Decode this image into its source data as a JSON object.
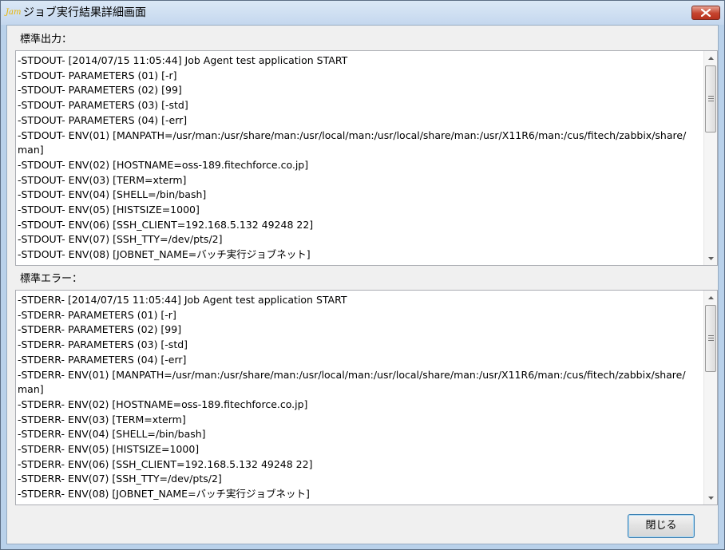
{
  "window": {
    "icon_text": "Jam",
    "title": "ジョブ実行結果詳細画面"
  },
  "stdout": {
    "label": "標準出力：",
    "lines": [
      "-STDOUT- [2014/07/15 11:05:44] Job Agent test application START",
      "-STDOUT- PARAMETERS (01) [-r]",
      "-STDOUT- PARAMETERS (02) [99]",
      "-STDOUT- PARAMETERS (03) [-std]",
      "-STDOUT- PARAMETERS (04) [-err]",
      "-STDOUT- ENV(01) [MANPATH=/usr/man:/usr/share/man:/usr/local/man:/usr/local/share/man:/usr/X11R6/man:/cus/fitech/zabbix/share/man]",
      "-STDOUT- ENV(02) [HOSTNAME=oss-189.fitechforce.co.jp]",
      "-STDOUT- ENV(03) [TERM=xterm]",
      "-STDOUT- ENV(04) [SHELL=/bin/bash]",
      "-STDOUT- ENV(05) [HISTSIZE=1000]",
      "-STDOUT- ENV(06) [SSH_CLIENT=192.168.5.132 49248 22]",
      "-STDOUT- ENV(07) [SSH_TTY=/dev/pts/2]",
      "-STDOUT- ENV(08) [JOBNET_NAME=バッチ実行ジョブネット]"
    ]
  },
  "stderr": {
    "label": "標準エラー：",
    "lines": [
      "-STDERR- [2014/07/15 11:05:44] Job Agent test application START",
      "-STDERR- PARAMETERS (01) [-r]",
      "-STDERR- PARAMETERS (02) [99]",
      "-STDERR- PARAMETERS (03) [-std]",
      "-STDERR- PARAMETERS (04) [-err]",
      "-STDERR- ENV(01) [MANPATH=/usr/man:/usr/share/man:/usr/local/man:/usr/local/share/man:/usr/X11R6/man:/cus/fitech/zabbix/share/man]",
      "-STDERR- ENV(02) [HOSTNAME=oss-189.fitechforce.co.jp]",
      "-STDERR- ENV(03) [TERM=xterm]",
      "-STDERR- ENV(04) [SHELL=/bin/bash]",
      "-STDERR- ENV(05) [HISTSIZE=1000]",
      "-STDERR- ENV(06) [SSH_CLIENT=192.168.5.132 49248 22]",
      "-STDERR- ENV(07) [SSH_TTY=/dev/pts/2]",
      "-STDERR- ENV(08) [JOBNET_NAME=バッチ実行ジョブネット]"
    ]
  },
  "buttons": {
    "close_label": "閉じる"
  },
  "icons": {
    "window_close": "close-icon",
    "scroll_up": "chevron-up-icon",
    "scroll_down": "chevron-down-icon"
  }
}
